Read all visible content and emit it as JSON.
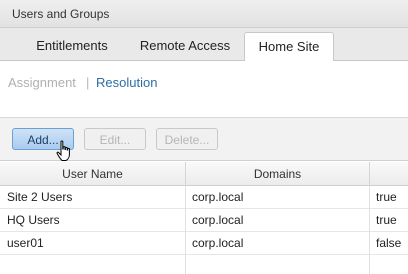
{
  "window": {
    "title": "Users and Groups"
  },
  "tabs": [
    {
      "label": "Entitlements",
      "active": false
    },
    {
      "label": "Remote Access",
      "active": false
    },
    {
      "label": "Home Site",
      "active": true
    }
  ],
  "subnav": {
    "assignment": "Assignment",
    "separator": "|",
    "resolution": "Resolution"
  },
  "toolbar": {
    "add": "Add...",
    "edit": "Edit...",
    "delete": "Delete..."
  },
  "table": {
    "columns": [
      "User Name",
      "Domains",
      ""
    ],
    "rows": [
      {
        "name": "Site 2 Users",
        "domain": "corp.local",
        "value": "true"
      },
      {
        "name": "HQ Users",
        "domain": "corp.local",
        "value": "true"
      },
      {
        "name": "user01",
        "domain": "corp.local",
        "value": "false"
      }
    ]
  },
  "colors": {
    "accent": "#2f6ea5",
    "add_button": "#a9cbef"
  },
  "icons": {
    "cursor": "hand-pointer-icon"
  }
}
